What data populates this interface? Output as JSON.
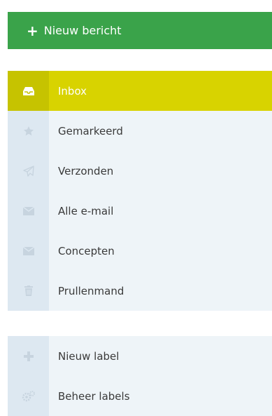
{
  "new_message": {
    "label": "Nieuw bericht",
    "icon": "plus-icon",
    "color": "#3aa34a"
  },
  "folders": [
    {
      "label": "Inbox",
      "icon": "inbox-icon",
      "active": true
    },
    {
      "label": "Gemarkeerd",
      "icon": "star-icon",
      "active": false
    },
    {
      "label": "Verzonden",
      "icon": "paper-plane-icon",
      "active": false
    },
    {
      "label": "Alle e-mail",
      "icon": "envelope-icon",
      "active": false
    },
    {
      "label": "Concepten",
      "icon": "envelope-icon",
      "active": false
    },
    {
      "label": "Prullenmand",
      "icon": "trash-icon",
      "active": false
    }
  ],
  "labels_menu": [
    {
      "label": "Nieuw label",
      "icon": "plus-icon"
    },
    {
      "label": "Beheer labels",
      "icon": "gears-icon"
    }
  ],
  "colors": {
    "active": "#d8d300",
    "icon_muted": "#c7d4df"
  }
}
